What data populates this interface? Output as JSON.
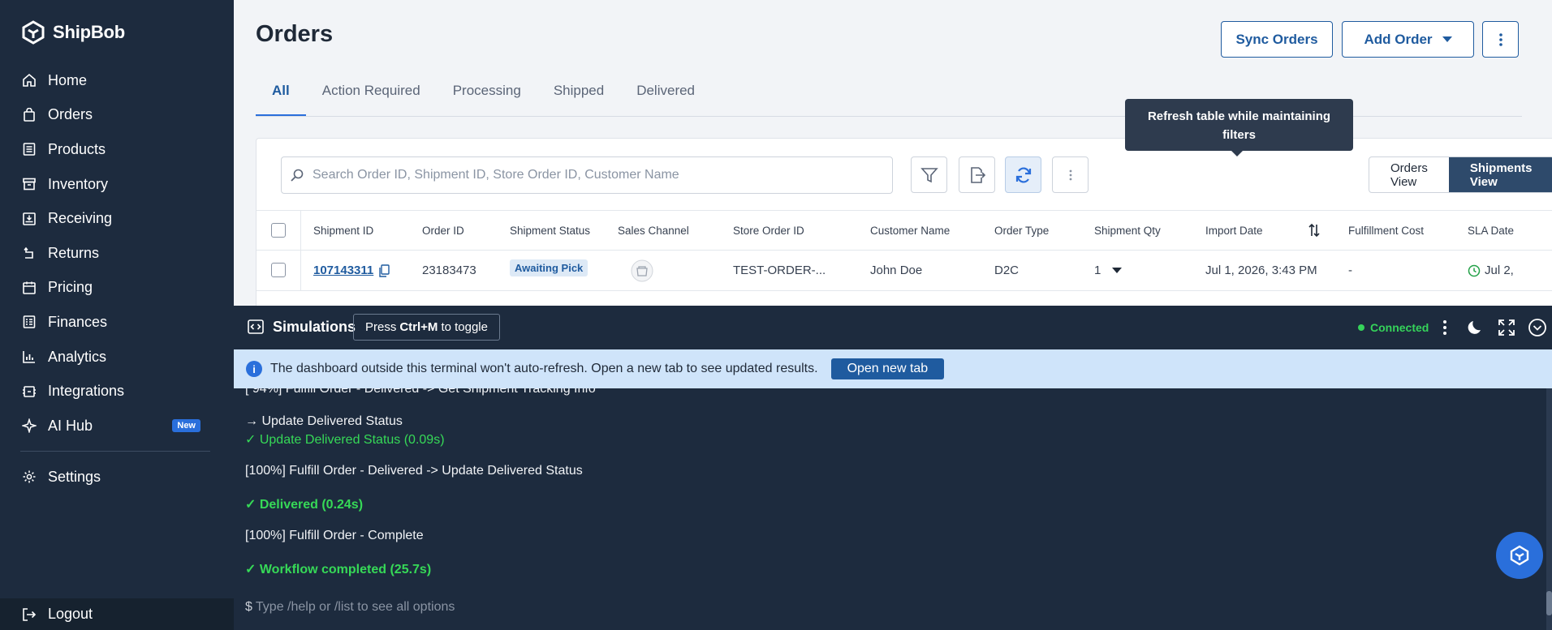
{
  "brand": {
    "name": "ShipBob"
  },
  "sidebar": {
    "items": [
      {
        "label": "Home",
        "icon": "home-icon"
      },
      {
        "label": "Orders",
        "icon": "shopping-bag-icon"
      },
      {
        "label": "Products",
        "icon": "list-icon"
      },
      {
        "label": "Inventory",
        "icon": "archive-box-icon"
      },
      {
        "label": "Receiving",
        "icon": "inbox-arrow-icon"
      },
      {
        "label": "Returns",
        "icon": "return-icon"
      },
      {
        "label": "Pricing",
        "icon": "calendar-icon"
      },
      {
        "label": "Finances",
        "icon": "finance-list-icon"
      },
      {
        "label": "Analytics",
        "icon": "bar-chart-icon"
      },
      {
        "label": "Integrations",
        "icon": "integrations-icon"
      },
      {
        "label": "AI Hub",
        "icon": "ai-sparkle-icon",
        "badge": "New"
      }
    ],
    "settings_label": "Settings",
    "logout_label": "Logout"
  },
  "page": {
    "title": "Orders",
    "sync_orders_label": "Sync Orders",
    "add_order_label": "Add Order"
  },
  "tabs": [
    {
      "label": "All",
      "active": true
    },
    {
      "label": "Action Required"
    },
    {
      "label": "Processing"
    },
    {
      "label": "Shipped"
    },
    {
      "label": "Delivered"
    }
  ],
  "toolbar": {
    "search_placeholder": "Search Order ID, Shipment ID, Store Order ID, Customer Name",
    "tooltip": "Refresh table while maintaining filters",
    "views": [
      "Orders View",
      "Shipments View"
    ],
    "active_view": "Shipments View"
  },
  "table": {
    "columns": [
      "Shipment ID",
      "Order ID",
      "Shipment Status",
      "Sales Channel",
      "Store Order ID",
      "Customer Name",
      "Order Type",
      "Shipment Qty",
      "Import Date",
      "Fulfillment Cost",
      "SLA Date"
    ],
    "rows": [
      {
        "shipment_id": "107143311",
        "order_id": "23183473",
        "status": "Awaiting Pick",
        "store_order_id": "TEST-ORDER-...",
        "customer_name": "John Doe",
        "order_type": "D2C",
        "qty": "1",
        "import_date": "Jul 1, 2026, 3:43 PM",
        "fulfillment_cost": "-",
        "sla_date": "Jul 2,"
      }
    ]
  },
  "terminal": {
    "title": "Simulations",
    "toggle_hint_prefix": "Press",
    "toggle_hint_key": "Ctrl+M",
    "toggle_hint_suffix": "to toggle",
    "status": "Connected",
    "info_message": "The dashboard outside this terminal won't auto-refresh. Open a new tab to see updated results.",
    "open_tab_label": "Open new tab",
    "logs": [
      {
        "text": "[ 94%] Fulfill Order - Delivered -> Get Shipment Tracking Info",
        "style": "white"
      },
      {
        "text": "→ Update Delivered Status",
        "style": "white"
      },
      {
        "text": "✓ Update Delivered Status (0.09s)",
        "style": "green"
      },
      {
        "text": "[100%] Fulfill Order - Delivered -> Update Delivered Status",
        "style": "white"
      },
      {
        "text": "✓ Delivered (0.24s)",
        "style": "green-bold"
      },
      {
        "text": "[100%] Fulfill Order - Complete",
        "style": "white"
      },
      {
        "text": "✓ Workflow completed (25.7s)",
        "style": "green-bold"
      }
    ],
    "prompt_symbol": "$",
    "prompt_placeholder": "Type /help or /list to see all options"
  },
  "colors": {
    "sidebar_bg": "#1d2b3e",
    "accent": "#1f5b9f",
    "success": "#36d957",
    "info_bg": "#cfe4fa"
  }
}
